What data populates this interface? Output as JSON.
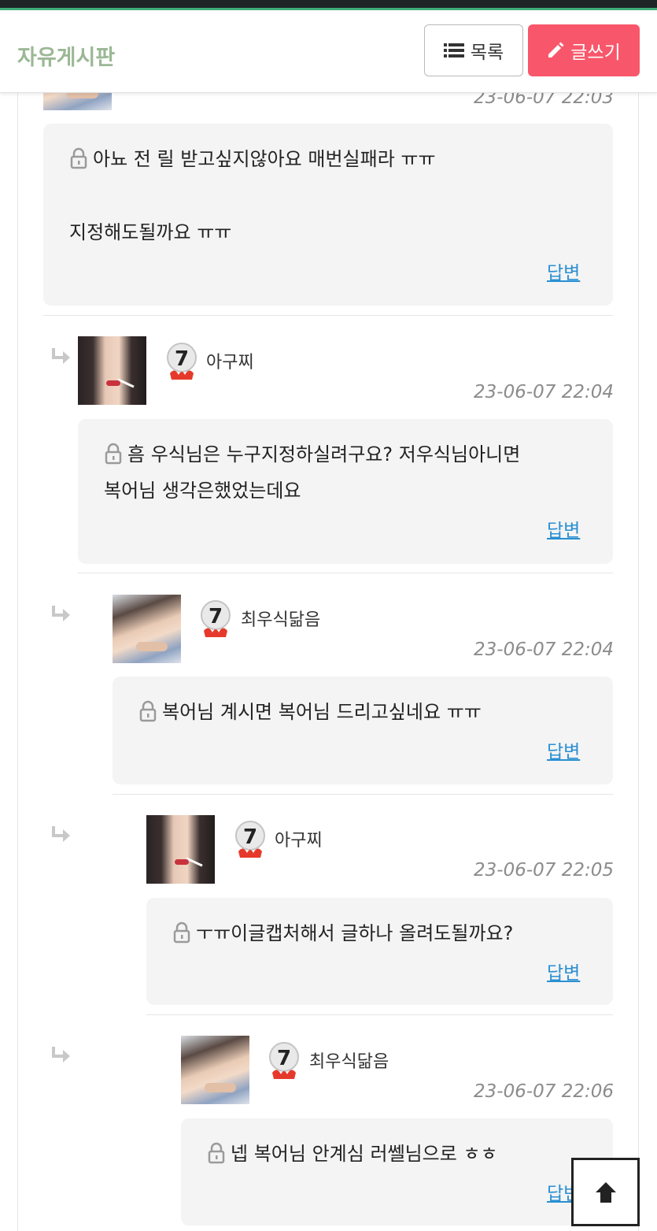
{
  "header": {
    "board_title": "자유게시판",
    "list_button": "목록",
    "list_icon": "list-icon",
    "write_button": "글쓰기",
    "write_icon": "pencil-icon",
    "write_color": "#f8576b",
    "title_color": "#9bb895"
  },
  "comments": [
    {
      "date": "23-06-07 22:03",
      "locked": true,
      "lines": [
        "아뇨 전 릴 받고싶지않아요 매번실패라 ㅠㅠ",
        "",
        "지정해도될까요 ㅠㅠ"
      ],
      "reply_label": "답변"
    },
    {
      "author": "아구찌",
      "level": "7",
      "date": "23-06-07 22:04",
      "locked": true,
      "lines": [
        "흠 우식님은 누구지정하실려구요? 저우식님아니면",
        "복어님  생각은했었는데요"
      ],
      "reply_label": "답변"
    },
    {
      "author": "최우식닮음",
      "level": "7",
      "date": "23-06-07 22:04",
      "locked": true,
      "lines": [
        "복어님 계시면 복어님 드리고싶네요 ㅠㅠ"
      ],
      "reply_label": "답변"
    },
    {
      "author": "아구찌",
      "level": "7",
      "date": "23-06-07 22:05",
      "locked": true,
      "lines": [
        "ㅜㅠ이글캡처해서 글하나 올려도될까요?"
      ],
      "reply_label": "답변"
    },
    {
      "author": "최우식닮음",
      "level": "7",
      "date": "23-06-07 22:06",
      "locked": true,
      "lines": [
        "넵 복어님 안계심 러쎌님으로 ㅎㅎ"
      ],
      "reply_label": "답변"
    }
  ],
  "icons": {
    "reply_arrow": "reply-arrow-icon",
    "lock": "lock-icon",
    "scroll_top": "arrow-up-icon"
  }
}
